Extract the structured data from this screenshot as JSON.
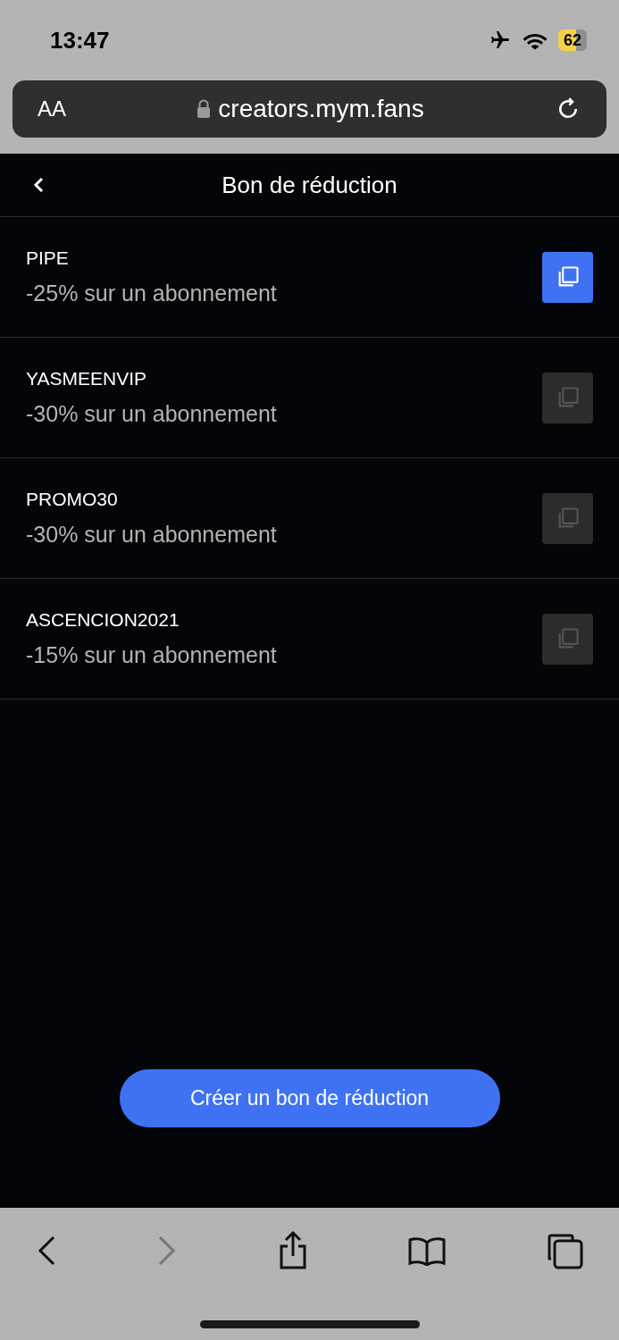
{
  "status_bar": {
    "time": "13:47",
    "battery": "62"
  },
  "address_bar": {
    "text_size": "AA",
    "url": "creators.mym.fans"
  },
  "header": {
    "title": "Bon de réduction"
  },
  "coupons": [
    {
      "code": "PIPE",
      "description": "-25% sur un abonnement",
      "selected": true
    },
    {
      "code": "YASMEENVIP",
      "description": "-30% sur un abonnement",
      "selected": false
    },
    {
      "code": "PROMO30",
      "description": "-30% sur un abonnement",
      "selected": false
    },
    {
      "code": "ASCENCION2021",
      "description": "-15% sur un abonnement",
      "selected": false
    }
  ],
  "create_button": "Créer un bon de réduction",
  "toolbar": {
    "back_disabled": false,
    "forward_disabled": true
  }
}
